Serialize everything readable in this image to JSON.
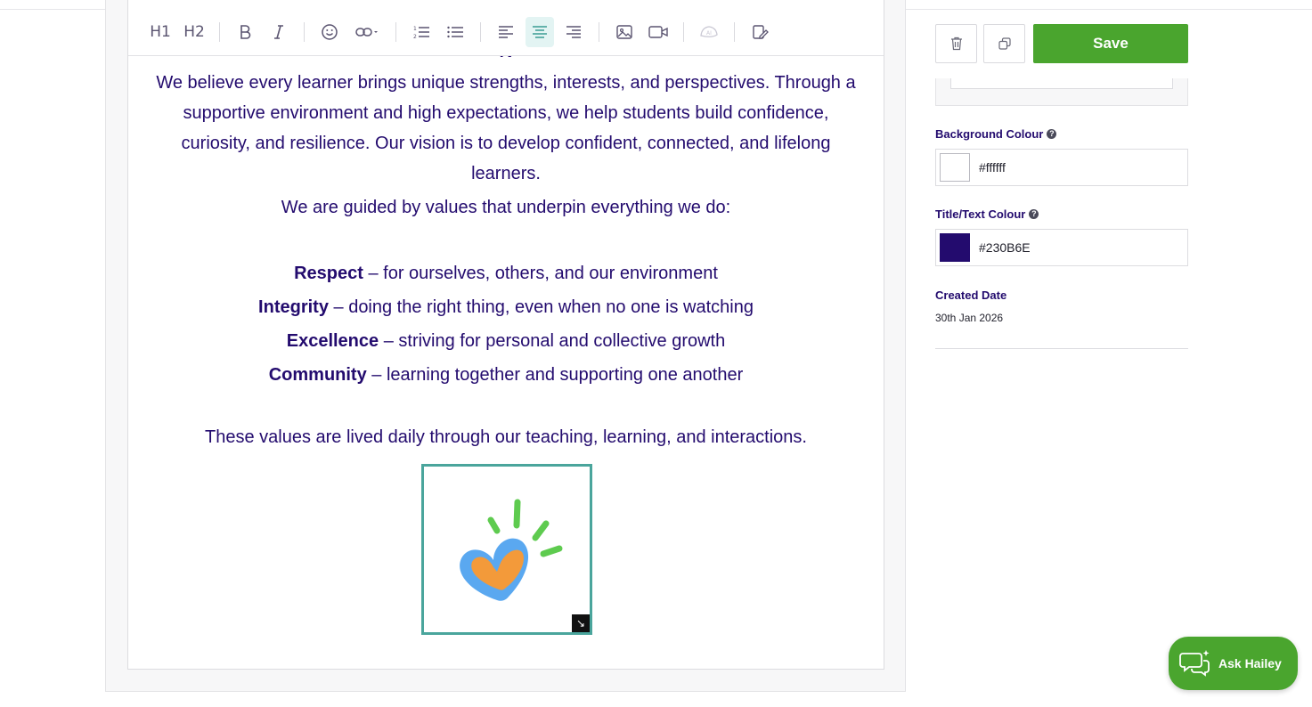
{
  "editor": {
    "toolbar": {
      "h1_label": "H1",
      "h2_label": "H2",
      "icons": [
        "bold-icon",
        "italic-icon",
        "emoji-icon",
        "link-icon",
        "ordered-list-icon",
        "bullet-list-icon",
        "align-left-icon",
        "align-center-icon",
        "align-right-icon",
        "image-icon",
        "video-icon",
        "ai-icon",
        "edit-clear-icon"
      ],
      "active_tool": "align-center"
    },
    "content": {
      "paragraph1": "We believe every learner brings unique strengths, interests, and perspectives. Through a supportive environment and high expectations, we help students build confidence, curiosity, and resilience. Our vision is to develop confident, connected, and lifelong learners.",
      "paragraph2": "We are guided by values that underpin everything we do:",
      "values": [
        {
          "term": "Respect",
          "desc": " – for ourselves, others, and our environment"
        },
        {
          "term": "Integrity",
          "desc": " – doing the right thing, even when no one is watching"
        },
        {
          "term": "Excellence",
          "desc": " – striving for personal and collective growth"
        },
        {
          "term": "Community",
          "desc": " – learning together and supporting one another"
        }
      ],
      "paragraph3": "These values are lived daily through our teaching, learning, and interactions.",
      "image": {
        "name": "heart-logo",
        "colors": {
          "heart_outline": "#5aa8f0",
          "heart_fill": "#f39a3a",
          "rays": "#5ecb4f"
        }
      }
    }
  },
  "sidebar": {
    "delete_icon": "trash-icon",
    "duplicate_icon": "copy-icon",
    "save_label": "Save",
    "background_colour": {
      "label": "Background Colour",
      "value": "#ffffff"
    },
    "title_text_colour": {
      "label": "Title/Text Colour",
      "value": "#230B6E"
    },
    "created_date": {
      "label": "Created Date",
      "value": "30th Jan 2026"
    }
  },
  "help_widget": {
    "label": "Ask Hailey",
    "icon": "chat-bubbles-icon"
  },
  "colors": {
    "accent_green": "#4aa52e",
    "text_navy": "#230B6E",
    "active_teal": "#4aa59c"
  }
}
